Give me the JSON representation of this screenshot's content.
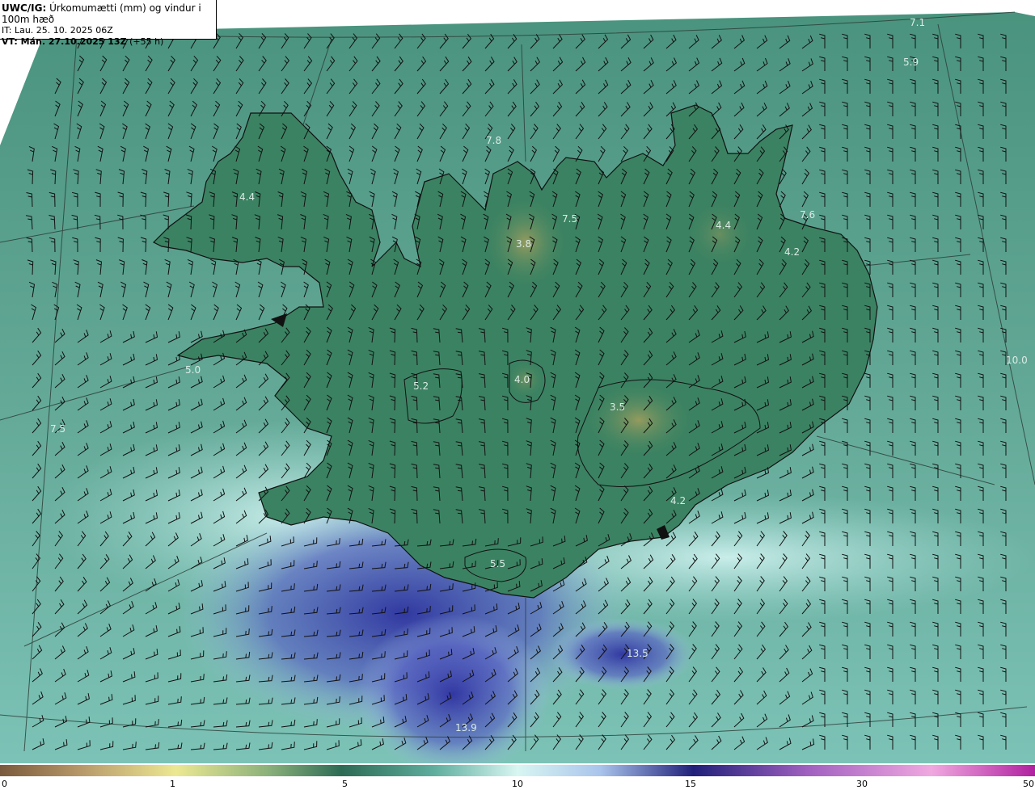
{
  "header": {
    "model_label": "UWC/IG:",
    "field_title": "Úrkomumætti (mm) og vindur i 100m hæð",
    "init_time": "IT: Lau. 25. 10. 2025 06Z",
    "valid_prefix": "VT: Mán. 27.10.2025 13Z",
    "lead_time": "(+55 h)"
  },
  "map_labels": [
    {
      "text": "7.1"
    },
    {
      "text": "5.9"
    },
    {
      "text": "7.8"
    },
    {
      "text": "4.4"
    },
    {
      "text": "7.5"
    },
    {
      "text": "3.8"
    },
    {
      "text": "4.4"
    },
    {
      "text": "7.6"
    },
    {
      "text": "4.2"
    },
    {
      "text": "5.0"
    },
    {
      "text": "5.2"
    },
    {
      "text": "4.0"
    },
    {
      "text": "3.5"
    },
    {
      "text": "7.5"
    },
    {
      "text": "4.2"
    },
    {
      "text": "5.5"
    },
    {
      "text": "10.0"
    },
    {
      "text": "13.5"
    },
    {
      "text": "13.9"
    }
  ],
  "colorbar": {
    "ticks": [
      "0",
      "1",
      "5",
      "10",
      "15",
      "30",
      "50"
    ],
    "colors": [
      "#7a5a3c",
      "#c8b07a",
      "#ece892",
      "#2d6b55",
      "#3f8a78",
      "#7fcfc9",
      "#d8f6f2",
      "#a9c4ec",
      "#4a54b8",
      "#20207a",
      "#b070c8",
      "#f0a8e0",
      "#b020a0"
    ]
  },
  "colors": {
    "sea": "#4f9a86",
    "land": "#3f8464",
    "highland": "#8a9a62",
    "precip_light": "#cdeff0",
    "precip_heavy": "#3a3fa8",
    "coast": "#111111"
  }
}
